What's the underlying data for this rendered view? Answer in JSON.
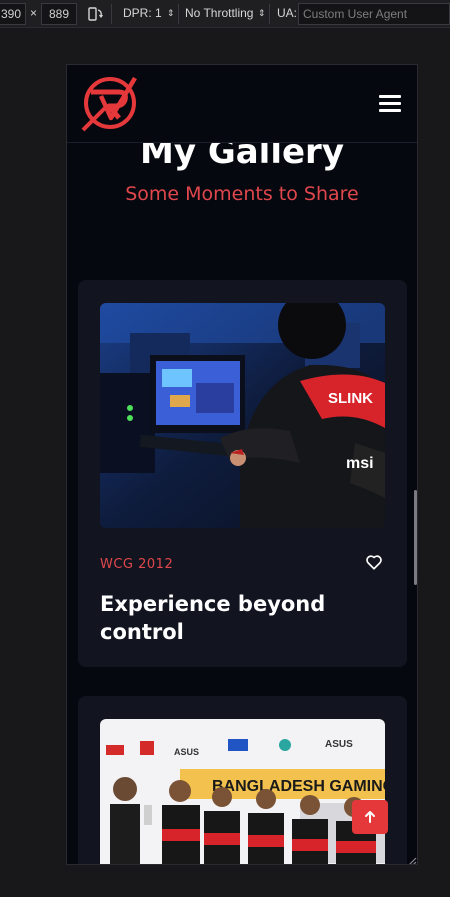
{
  "devtools": {
    "width_value": "390",
    "times": "×",
    "height_value": "889",
    "dpr_label": "DPR: 1",
    "throttle_label": "No Throttling",
    "ua_label": "UA:",
    "ua_placeholder": "Custom User Agent"
  },
  "gallery": {
    "title": "My Gallery",
    "subtitle": "Some Moments to Share"
  },
  "cards": [
    {
      "tag": "WCG 2012",
      "title": "Experience beyond control"
    },
    {
      "tag": "",
      "title": ""
    }
  ],
  "colors": {
    "accent": "#e0474c",
    "background": "#06080f",
    "card": "#121520"
  },
  "icons": {
    "menu": "hamburger-icon",
    "like": "heart-icon",
    "back_to_top": "arrow-up-icon",
    "rotate": "rotate-icon"
  }
}
